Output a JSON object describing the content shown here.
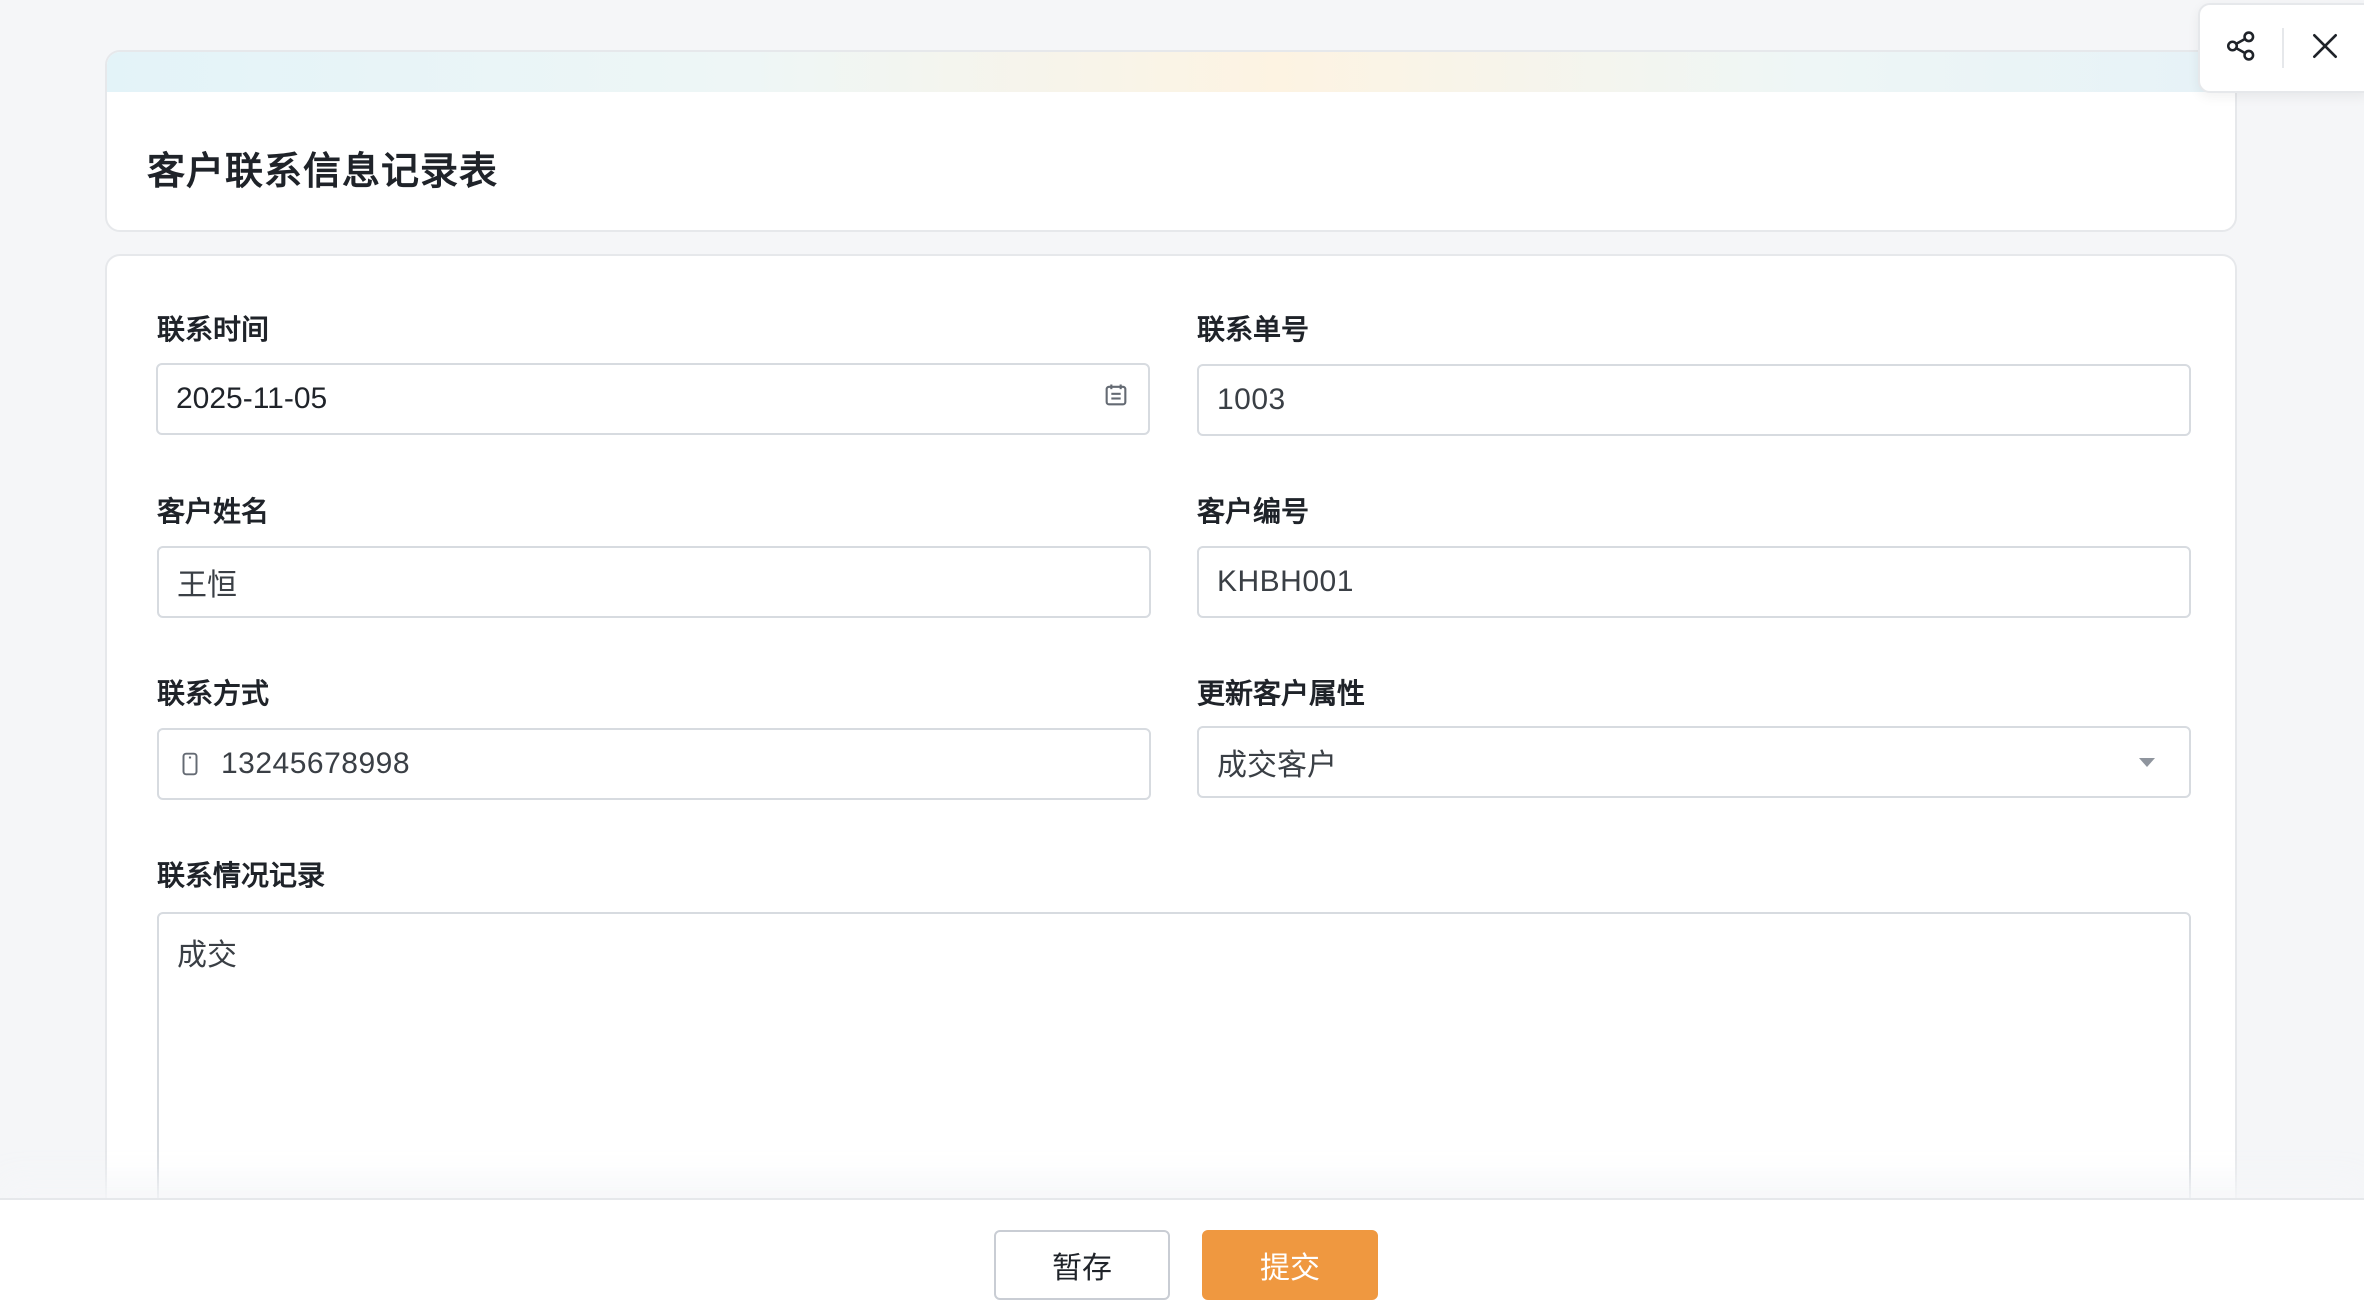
{
  "form": {
    "title": "客户联系信息记录表"
  },
  "actions": {
    "share_icon": "share-icon",
    "close_icon": "close-icon"
  },
  "fields": {
    "contact_time": {
      "label": "联系时间",
      "value": "2025-11-05"
    },
    "contact_no": {
      "label": "联系单号",
      "value": "1003"
    },
    "customer_name": {
      "label": "客户姓名",
      "value": "王恒"
    },
    "customer_code": {
      "label": "客户编号",
      "value": "KHBH001"
    },
    "contact_method": {
      "label": "联系方式",
      "value": "13245678998"
    },
    "customer_attr": {
      "label": "更新客户属性",
      "value": "成交客户"
    },
    "contact_record": {
      "label": "联系情况记录",
      "value": "成交"
    }
  },
  "footer": {
    "save_label": "暂存",
    "submit_label": "提交"
  },
  "colors": {
    "accent": "#ef9840",
    "border": "#d7dbe0",
    "background": "#f5f6f8"
  }
}
